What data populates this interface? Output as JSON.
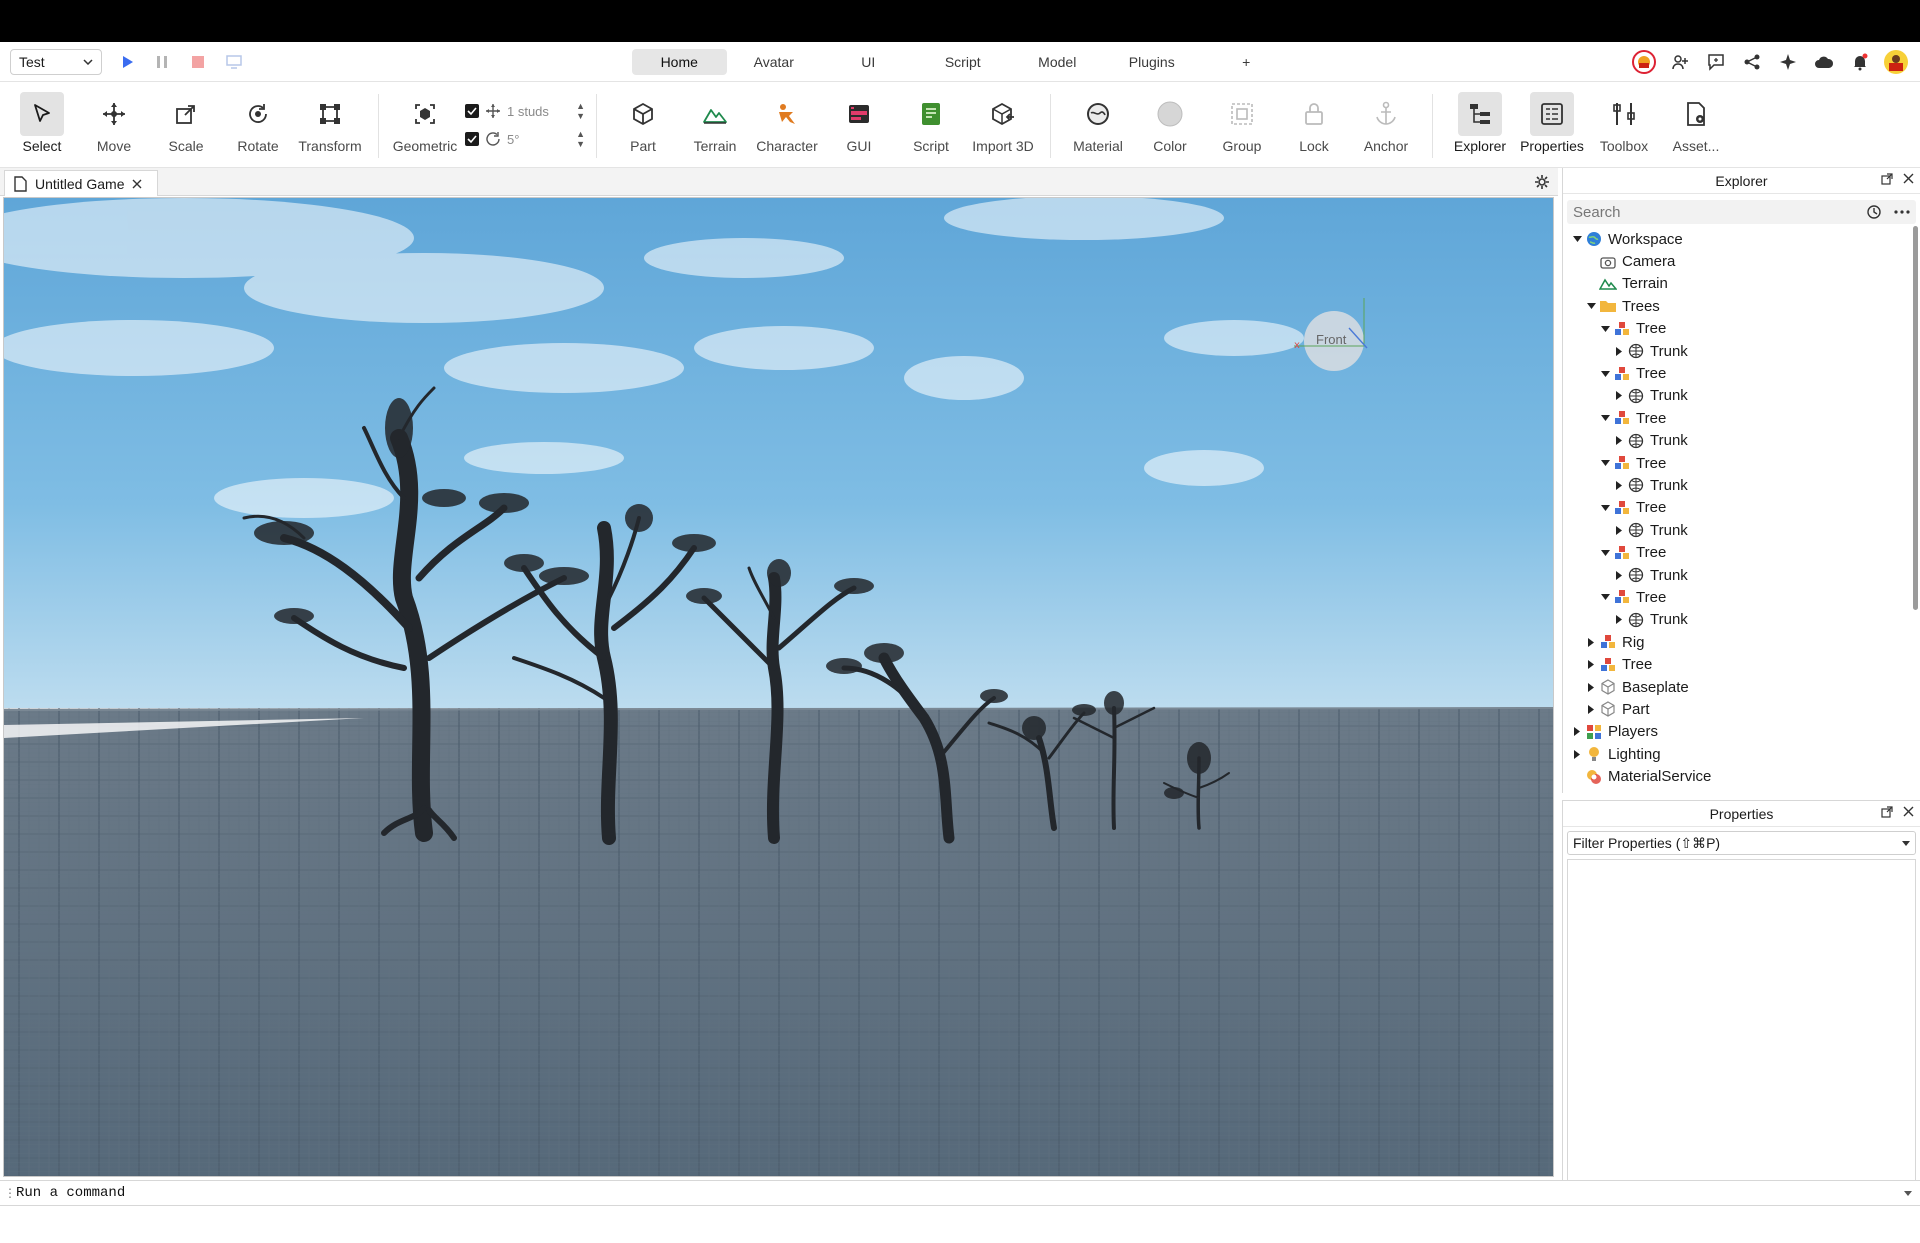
{
  "topbar": {
    "place": "Test",
    "tabs": [
      "Home",
      "Avatar",
      "UI",
      "Script",
      "Model",
      "Plugins",
      "+"
    ],
    "active_tab": "Home"
  },
  "ribbon": {
    "tools": [
      "Select",
      "Move",
      "Scale",
      "Rotate",
      "Transform",
      "Geometric",
      "Part",
      "Terrain",
      "Character",
      "GUI",
      "Script",
      "Import 3D",
      "Material",
      "Color",
      "Group",
      "Lock",
      "Anchor",
      "Explorer",
      "Properties",
      "Toolbox",
      "Asset..."
    ],
    "move_snap": "1 studs",
    "rotate_snap": "5°"
  },
  "doc_tab": {
    "title": "Untitled Game"
  },
  "viewport": {
    "view_cube_label": "Front"
  },
  "explorer": {
    "title": "Explorer",
    "search_placeholder": "Search",
    "items": [
      {
        "label": "Workspace",
        "icon": "globe-icon",
        "indent": 0,
        "arrow": "down"
      },
      {
        "label": "Camera",
        "icon": "camera-icon",
        "indent": 1,
        "arrow": "none"
      },
      {
        "label": "Terrain",
        "icon": "terrain-icon",
        "indent": 1,
        "arrow": "none"
      },
      {
        "label": "Trees",
        "icon": "folder-icon",
        "indent": 1,
        "arrow": "down"
      },
      {
        "label": "Tree",
        "icon": "model-icon",
        "indent": 2,
        "arrow": "down"
      },
      {
        "label": "Trunk",
        "icon": "meshpart-icon",
        "indent": 3,
        "arrow": "right"
      },
      {
        "label": "Tree",
        "icon": "model-icon",
        "indent": 2,
        "arrow": "down"
      },
      {
        "label": "Trunk",
        "icon": "meshpart-icon",
        "indent": 3,
        "arrow": "right"
      },
      {
        "label": "Tree",
        "icon": "model-icon",
        "indent": 2,
        "arrow": "down"
      },
      {
        "label": "Trunk",
        "icon": "meshpart-icon",
        "indent": 3,
        "arrow": "right"
      },
      {
        "label": "Tree",
        "icon": "model-icon",
        "indent": 2,
        "arrow": "down"
      },
      {
        "label": "Trunk",
        "icon": "meshpart-icon",
        "indent": 3,
        "arrow": "right"
      },
      {
        "label": "Tree",
        "icon": "model-icon",
        "indent": 2,
        "arrow": "down"
      },
      {
        "label": "Trunk",
        "icon": "meshpart-icon",
        "indent": 3,
        "arrow": "right"
      },
      {
        "label": "Tree",
        "icon": "model-icon",
        "indent": 2,
        "arrow": "down"
      },
      {
        "label": "Trunk",
        "icon": "meshpart-icon",
        "indent": 3,
        "arrow": "right"
      },
      {
        "label": "Tree",
        "icon": "model-icon",
        "indent": 2,
        "arrow": "down"
      },
      {
        "label": "Trunk",
        "icon": "meshpart-icon",
        "indent": 3,
        "arrow": "right"
      },
      {
        "label": "Rig",
        "icon": "model-icon",
        "indent": 1,
        "arrow": "right"
      },
      {
        "label": "Tree",
        "icon": "model-icon",
        "indent": 1,
        "arrow": "right"
      },
      {
        "label": "Baseplate",
        "icon": "part-icon",
        "indent": 1,
        "arrow": "right"
      },
      {
        "label": "Part",
        "icon": "part-icon",
        "indent": 1,
        "arrow": "right"
      },
      {
        "label": "Players",
        "icon": "players-icon",
        "indent": 0,
        "arrow": "right"
      },
      {
        "label": "Lighting",
        "icon": "lighting-icon",
        "indent": 0,
        "arrow": "right"
      },
      {
        "label": "MaterialService",
        "icon": "material-service-icon",
        "indent": 0,
        "arrow": "none"
      }
    ]
  },
  "properties": {
    "title": "Properties",
    "filter_placeholder": "Filter Properties (⇧⌘P)"
  },
  "command_bar": {
    "placeholder": "Run a command"
  }
}
